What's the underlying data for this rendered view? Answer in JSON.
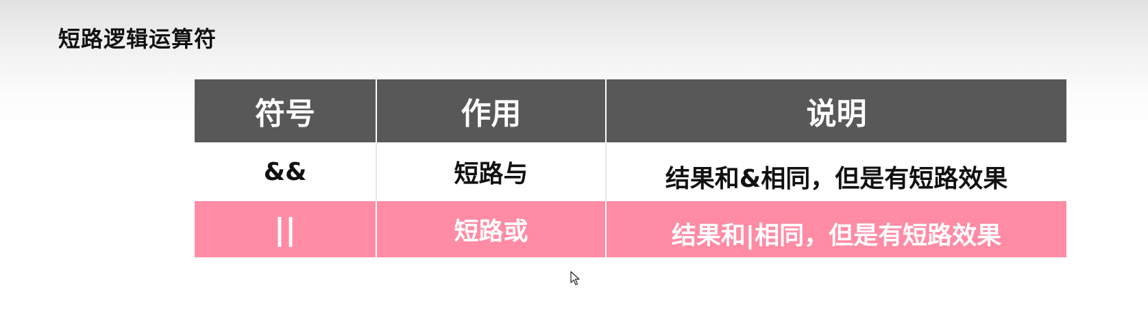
{
  "slide": {
    "title": "短路逻辑运算符"
  },
  "table": {
    "headers": [
      "符号",
      "作用",
      "说明"
    ],
    "rows": [
      {
        "symbol": "&&",
        "function": "短路与",
        "description": "结果和&相同，但是有短路效果"
      },
      {
        "symbol": "||",
        "function": "短路或",
        "description": "结果和|相同，但是有短路效果"
      }
    ]
  },
  "colors": {
    "header_bg": "#585858",
    "highlight_row_bg": "#ff8ba4",
    "text_dark": "#111111",
    "text_light": "#ffffff"
  },
  "icons": {
    "cursor": "mouse-pointer-icon"
  }
}
